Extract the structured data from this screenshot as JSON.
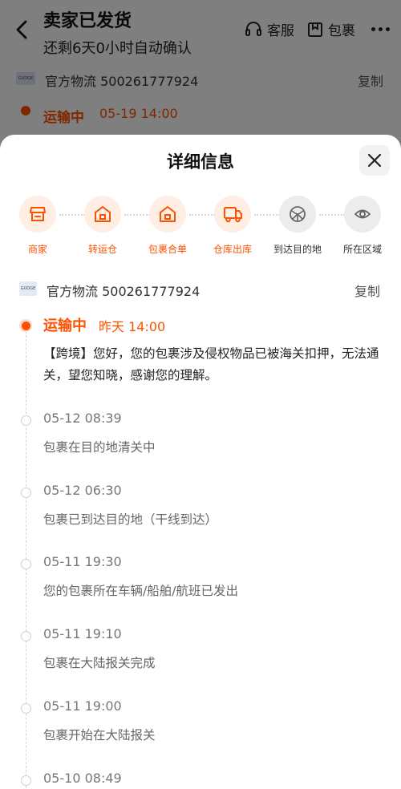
{
  "background": {
    "title": "卖家已发货",
    "subtitle": "还剩6天0小时自动确认",
    "actions": {
      "service": "客服",
      "package": "包裹"
    },
    "carrier_logo_text": "GUOGE",
    "carrier": "官方物流 500261777924",
    "copy": "复制",
    "status": "运输中",
    "status_time": "05-19 14:00"
  },
  "sheet": {
    "title": "详细信息",
    "steps": [
      {
        "label": "商家",
        "icon": "store-icon",
        "state": "done"
      },
      {
        "label": "转运仓",
        "icon": "warehouse-icon",
        "state": "done"
      },
      {
        "label": "包裹合单",
        "icon": "warehouse-icon",
        "state": "done"
      },
      {
        "label": "仓库出库",
        "icon": "truck-icon",
        "state": "done"
      },
      {
        "label": "到达目的地",
        "icon": "destination-icon",
        "state": "todo"
      },
      {
        "label": "所在区域",
        "icon": "location-icon",
        "state": "todo"
      }
    ],
    "carrier_logo_text": "GUOGE",
    "carrier": "官方物流 500261777924",
    "copy": "复制",
    "current": {
      "status": "运输中",
      "time": "昨天 14:00",
      "desc": "【跨境】您好，您的包裹涉及侵权物品已被海关扣押，无法通关，望您知晓，感谢您的理解。"
    },
    "events": [
      {
        "time": "05-12 08:39",
        "desc": "包裹在目的地清关中"
      },
      {
        "time": "05-12 06:30",
        "desc": "包裹已到达目的地（干线到达）"
      },
      {
        "time": "05-11 19:30",
        "desc": "您的包裹所在车辆/船舶/航班已发出"
      },
      {
        "time": "05-11 19:10",
        "desc": "包裹在大陆报关完成"
      },
      {
        "time": "05-11 19:00",
        "desc": "包裹开始在大陆报关"
      },
      {
        "time": "05-10 08:49",
        "desc": ""
      }
    ]
  },
  "colors": {
    "accent": "#ff5000",
    "accent_light": "#ffeee4",
    "inactive": "#ececec"
  }
}
